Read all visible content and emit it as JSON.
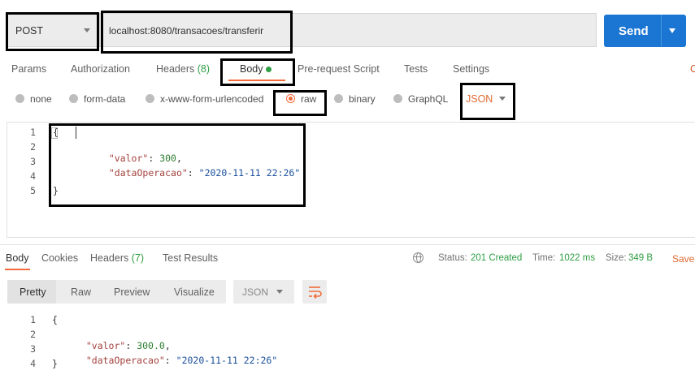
{
  "request": {
    "method": "POST",
    "url": "localhost:8080/transacoes/transferir",
    "send_label": "Send"
  },
  "request_tabs": {
    "params": "Params",
    "authorization": "Authorization",
    "headers": "Headers",
    "headers_count": "(8)",
    "body": "Body",
    "pre_request": "Pre-request Script",
    "tests": "Tests",
    "settings": "Settings",
    "edge_char": "C"
  },
  "body_types": {
    "none": "none",
    "form_data": "form-data",
    "urlencoded": "x-www-form-urlencoded",
    "raw": "raw",
    "binary": "binary",
    "graphql": "GraphQL",
    "format": "JSON",
    "selected": "raw"
  },
  "request_body": {
    "line_numbers": [
      "1",
      "2",
      "3",
      "4",
      "5"
    ],
    "open_brace": "{",
    "key1": "\"valor\"",
    "val1": "300",
    "key2": "\"dataOperacao\"",
    "val2": "\"2020-11-11 22:26\"",
    "close_brace": "}"
  },
  "response_tabs": {
    "body": "Body",
    "cookies": "Cookies",
    "headers": "Headers",
    "headers_count": "(7)",
    "test_results": "Test Results"
  },
  "response_status": {
    "status_label": "Status:",
    "status_value": "201 Created",
    "time_label": "Time:",
    "time_value": "1022 ms",
    "size_label": "Size:",
    "size_value": "349 B",
    "save_label": "Save"
  },
  "response_view": {
    "pretty": "Pretty",
    "raw": "Raw",
    "preview": "Preview",
    "visualize": "Visualize",
    "format": "JSON"
  },
  "response_body": {
    "line_numbers": [
      "1",
      "2",
      "3",
      "4"
    ],
    "open_brace": "{",
    "key1": "\"valor\"",
    "val1": "300.0",
    "key2": "\"dataOperacao\"",
    "val2": "\"2020-11-11 22:26\"",
    "close_brace": "}"
  },
  "colors": {
    "accent": "#f26b3a",
    "send_button": "#1a76d2",
    "status_ok": "#2e9e44"
  }
}
